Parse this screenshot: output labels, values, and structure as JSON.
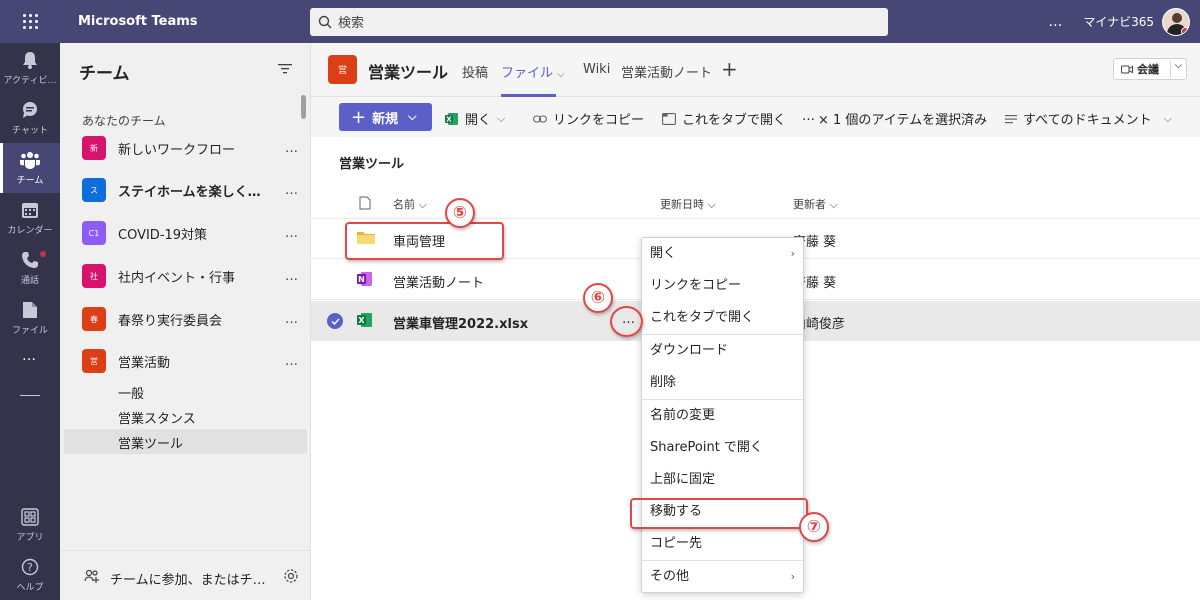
{
  "app": {
    "title": "Microsoft Teams",
    "org": "マイナビ365"
  },
  "search": {
    "placeholder": "検索"
  },
  "rail": [
    {
      "label": "アクティビ…",
      "icon": "bell-icon"
    },
    {
      "label": "チャット",
      "icon": "chat-icon"
    },
    {
      "label": "チーム",
      "icon": "teams-icon"
    },
    {
      "label": "カレンダー",
      "icon": "calendar-icon"
    },
    {
      "label": "通話",
      "icon": "phone-icon"
    },
    {
      "label": "ファイル",
      "icon": "file-icon"
    },
    {
      "label": "アプリ",
      "icon": "apps-icon"
    },
    {
      "label": "ヘルプ",
      "icon": "help-icon"
    }
  ],
  "rail_more": "…",
  "panel": {
    "title": "チーム",
    "section": "あなたのチーム",
    "teams": [
      {
        "name": "新しいワークフロー",
        "tile": "新",
        "color": "#d6146b",
        "bold": false
      },
      {
        "name": "ステイホームを楽しく…",
        "tile": "ス",
        "color": "#0f6cdb",
        "bold": true
      },
      {
        "name": "COVID-19対策",
        "tile": "C1",
        "color": "#8b5cf6",
        "bold": false
      },
      {
        "name": "社内イベント・行事",
        "tile": "社",
        "color": "#d6146b",
        "bold": false
      },
      {
        "name": "春祭り実行委員会",
        "tile": "春",
        "color": "#dc3e15",
        "bold": false
      },
      {
        "name": "営業活動",
        "tile": "営",
        "color": "#dc3e15",
        "bold": false
      }
    ],
    "more": "…",
    "channels": [
      "一般",
      "営業スタンス",
      "営業ツール"
    ],
    "join": "チームに参加、またはチ…"
  },
  "channel": {
    "tile": "営",
    "title": "営業ツール",
    "tabs": [
      "投稿",
      "ファイル",
      "Wiki",
      "営業活動ノート"
    ],
    "tab_chevron": "⌵",
    "plus": "+",
    "meet": "会議",
    "meet_chevron": "⌵"
  },
  "toolbar": {
    "new": "新規",
    "new_plus": "+",
    "new_chevron": "⌵",
    "open": "開く",
    "open_chevron": "⌵",
    "copy_link": "リンクをコピー",
    "open_tab": "これをタブで開く",
    "more": "…",
    "selected": "× 1 個のアイテムを選択済み",
    "all_docs": "すべてのドキュメント",
    "all_docs_chevron": "⌵"
  },
  "files": {
    "folder_title": "営業ツール",
    "columns": {
      "name": "名前 ⌵",
      "modified": "更新日時 ⌵",
      "modified_by": "更新者 ⌵"
    },
    "rows": [
      {
        "name": "車両管理",
        "type": "folder",
        "modified_by": "齋藤 葵",
        "selected": false,
        "bold": false
      },
      {
        "name": "営業活動ノート",
        "type": "onenote",
        "modified_by": "齋藤 葵",
        "selected": false,
        "bold": false
      },
      {
        "name": "営業車管理2022.xlsx",
        "type": "excel",
        "modified_by": "山崎俊彦",
        "selected": true,
        "bold": true
      }
    ],
    "row_more": "…"
  },
  "context_menu": [
    {
      "label": "開く",
      "submenu": true
    },
    {
      "label": "リンクをコピー",
      "submenu": false
    },
    {
      "label": "これをタブで開く",
      "submenu": false
    },
    {
      "label": "ダウンロード",
      "submenu": false
    },
    {
      "label": "削除",
      "submenu": false
    },
    {
      "label": "名前の変更",
      "submenu": false
    },
    {
      "label": "SharePoint で開く",
      "submenu": false
    },
    {
      "label": "上部に固定",
      "submenu": false
    },
    {
      "label": "移動する",
      "submenu": false
    },
    {
      "label": "コピー先",
      "submenu": false
    },
    {
      "label": "その他",
      "submenu": true
    }
  ],
  "menu_arrow": "›",
  "annotations": [
    "⑤",
    "⑥",
    "⑦"
  ],
  "colors": {
    "accent": "#5b5fc7",
    "topbar": "#464775",
    "rail": "#33344a",
    "highlight": "#e04848"
  }
}
